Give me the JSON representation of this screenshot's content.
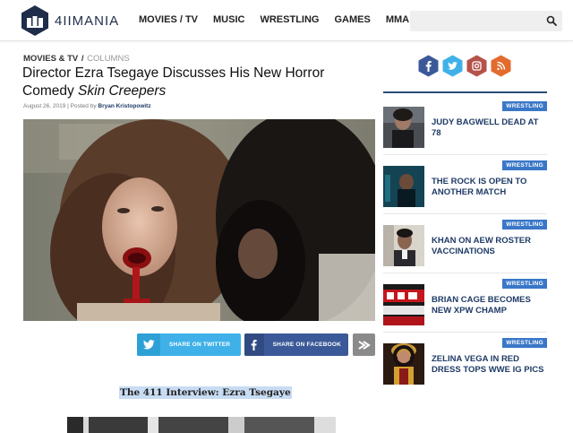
{
  "header": {
    "logo_text": "4IIMANIA",
    "nav": [
      "MOVIES / TV",
      "MUSIC",
      "WRESTLING",
      "GAMES",
      "MMA"
    ],
    "search": {
      "value": "",
      "placeholder": ""
    }
  },
  "article": {
    "breadcrumb": {
      "section": "MOVIES & TV",
      "separator": "/",
      "subsection": "COLUMNS"
    },
    "title_main": "Director Ezra Tsegaye Discusses His New Horror Comedy ",
    "title_italic": "Skin Creepers",
    "meta": {
      "date": "August 26, 2019",
      "posted_by_prefix": " | Posted by ",
      "author": "Bryan Kristopowitz"
    },
    "share": {
      "twitter_label": "SHARE ON TWITTER",
      "facebook_label": "SHARE ON FACEBOOK"
    },
    "subhead": "The 411 Interview: Ezra Tsegaye"
  },
  "sidebar": {
    "social_icons": [
      "facebook-icon",
      "twitter-icon",
      "instagram-icon",
      "rss-icon"
    ],
    "items": [
      {
        "tag": "WRESTLING",
        "headline": "JUDY BAGWELL DEAD AT 78"
      },
      {
        "tag": "WRESTLING",
        "headline": "THE ROCK IS OPEN TO ANOTHER MATCH"
      },
      {
        "tag": "WRESTLING",
        "headline": "KHAN ON AEW ROSTER VACCINATIONS"
      },
      {
        "tag": "WRESTLING",
        "headline": "BRIAN CAGE BECOMES NEW XPW CHAMP"
      },
      {
        "tag": "WRESTLING",
        "headline": "ZELINA VEGA IN RED DRESS TOPS WWE IG PICS"
      }
    ]
  },
  "colors": {
    "navy": "#1e3a66",
    "tag_blue": "#3a77c8",
    "twitter": "#3fb1e8",
    "facebook": "#3b5998",
    "instagram": "#b5524a",
    "rss": "#e36b2d"
  }
}
